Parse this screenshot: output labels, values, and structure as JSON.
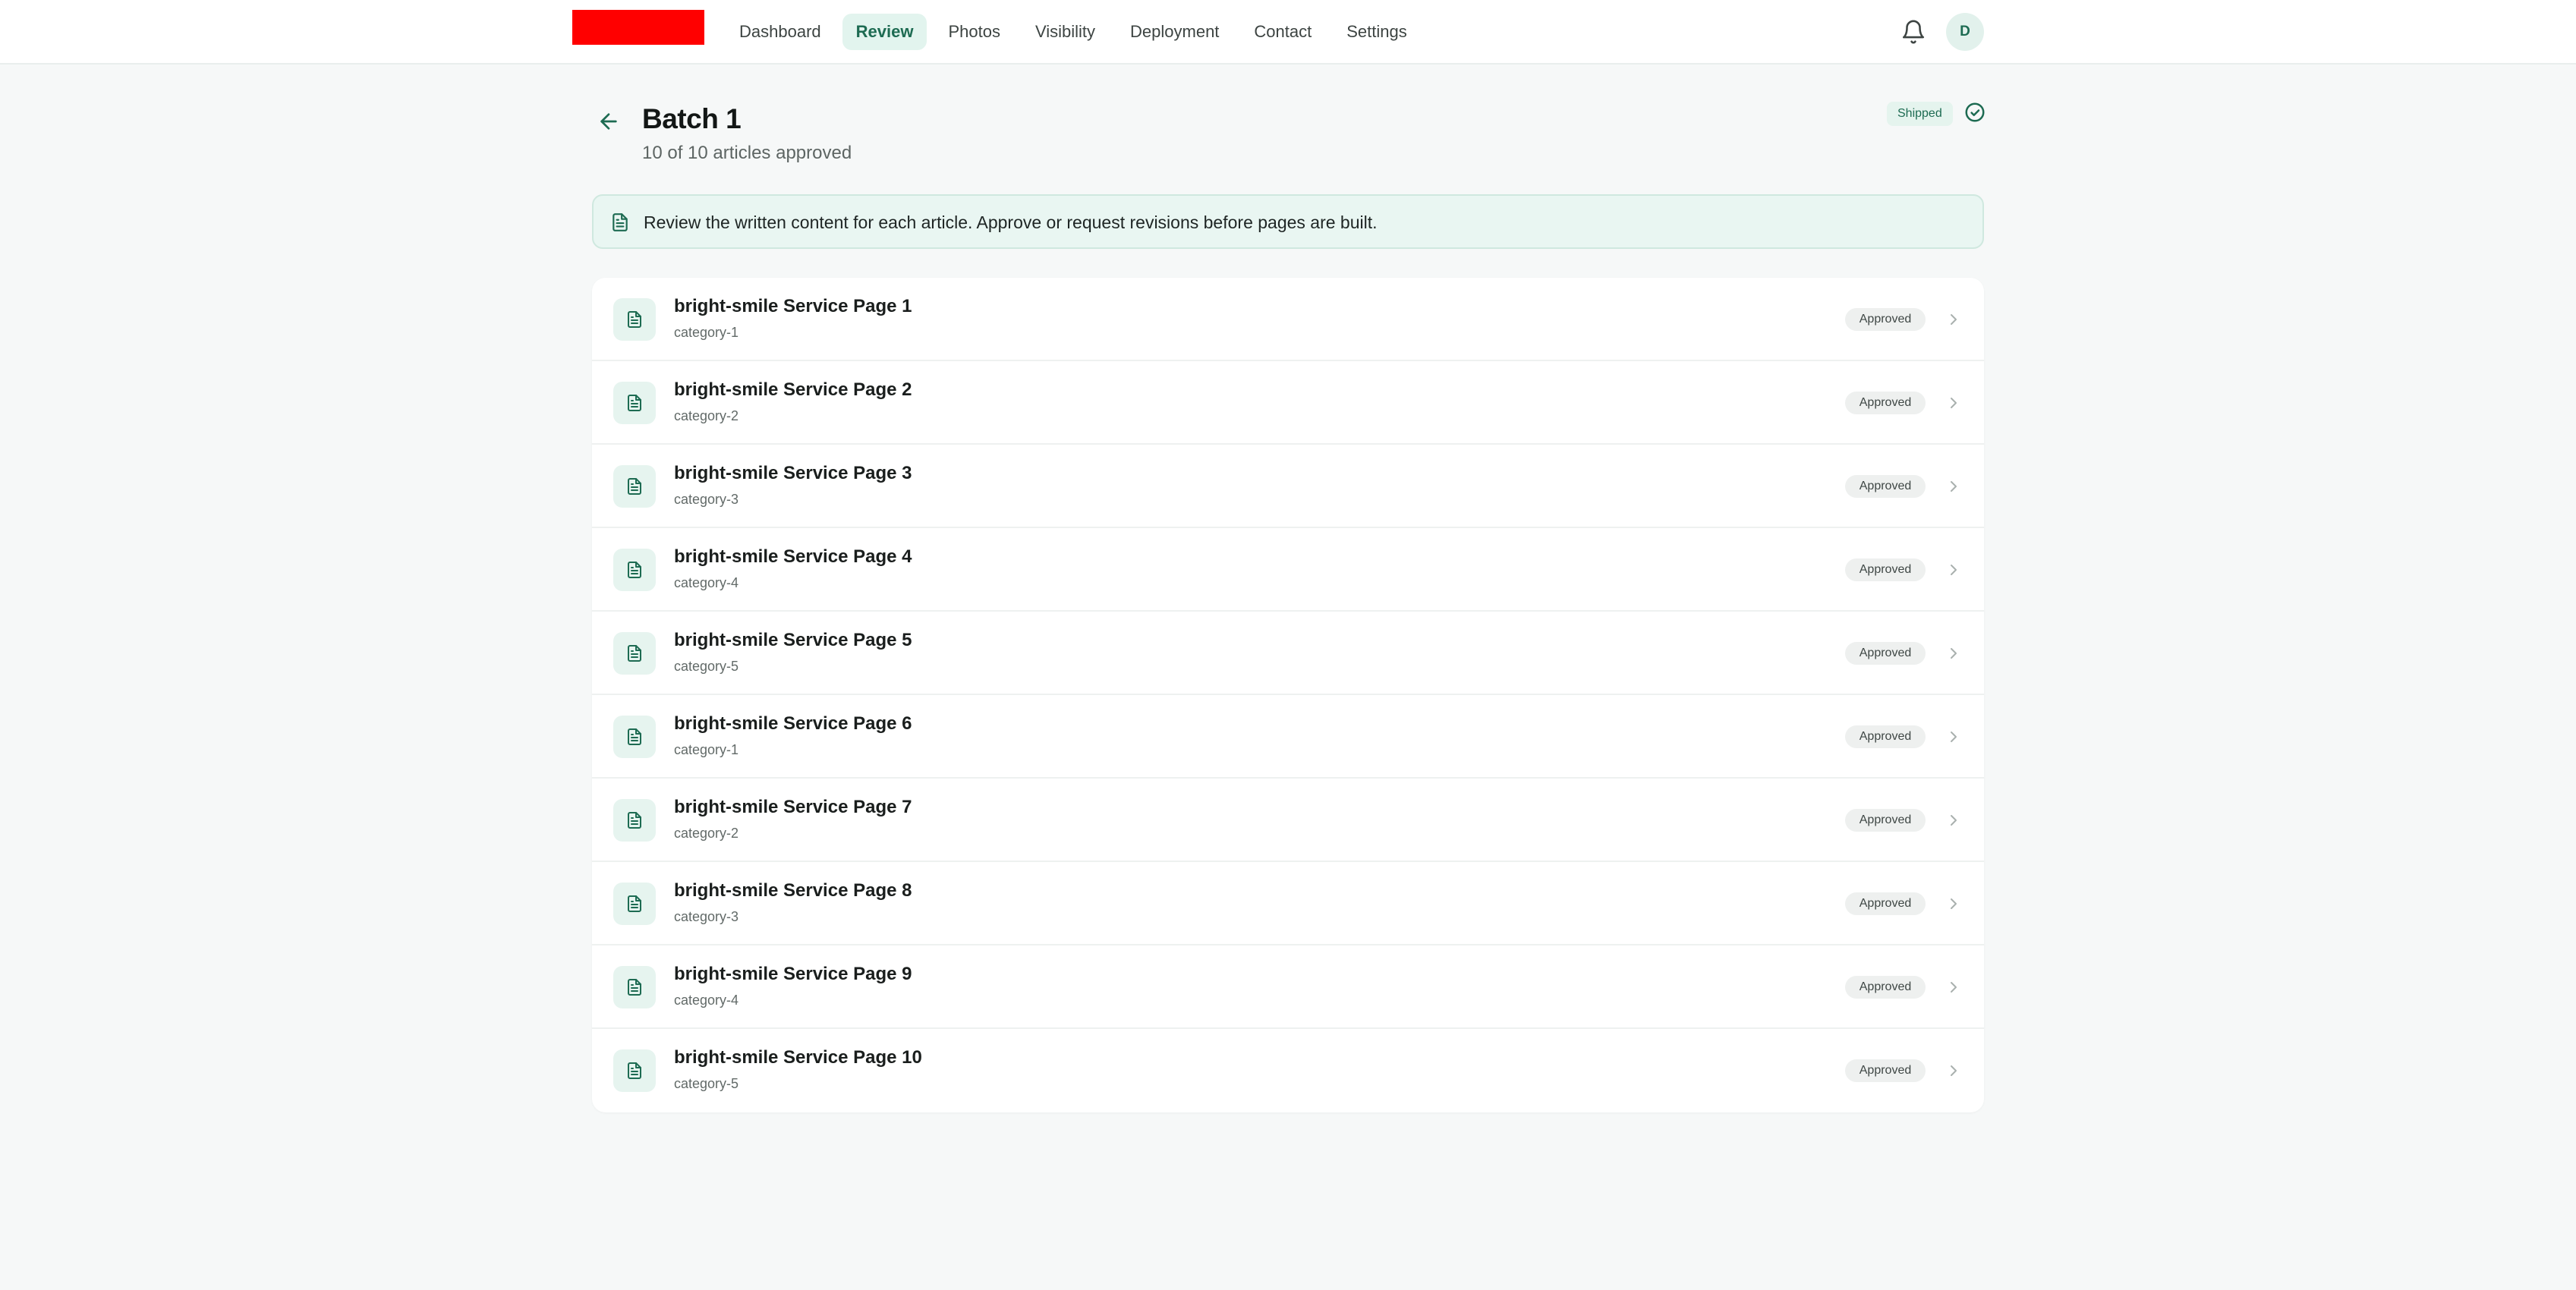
{
  "nav": {
    "items": [
      {
        "label": "Dashboard",
        "active": false
      },
      {
        "label": "Review",
        "active": true
      },
      {
        "label": "Photos",
        "active": false
      },
      {
        "label": "Visibility",
        "active": false
      },
      {
        "label": "Deployment",
        "active": false
      },
      {
        "label": "Contact",
        "active": false
      },
      {
        "label": "Settings",
        "active": false
      }
    ],
    "avatar_initial": "D",
    "icons": [
      "bell-icon"
    ]
  },
  "header": {
    "title": "Batch 1",
    "subtitle": "10 of 10 articles approved",
    "status": "Shipped",
    "icons": [
      "arrow-left-icon",
      "circle-check-icon"
    ]
  },
  "banner": {
    "text": "Review the written content for each article. Approve or request revisions before pages are built.",
    "icon": "document-icon"
  },
  "articles": [
    {
      "title": "bright-smile Service Page 1",
      "category": "category-1",
      "status": "Approved"
    },
    {
      "title": "bright-smile Service Page 2",
      "category": "category-2",
      "status": "Approved"
    },
    {
      "title": "bright-smile Service Page 3",
      "category": "category-3",
      "status": "Approved"
    },
    {
      "title": "bright-smile Service Page 4",
      "category": "category-4",
      "status": "Approved"
    },
    {
      "title": "bright-smile Service Page 5",
      "category": "category-5",
      "status": "Approved"
    },
    {
      "title": "bright-smile Service Page 6",
      "category": "category-1",
      "status": "Approved"
    },
    {
      "title": "bright-smile Service Page 7",
      "category": "category-2",
      "status": "Approved"
    },
    {
      "title": "bright-smile Service Page 8",
      "category": "category-3",
      "status": "Approved"
    },
    {
      "title": "bright-smile Service Page 9",
      "category": "category-4",
      "status": "Approved"
    },
    {
      "title": "bright-smile Service Page 10",
      "category": "category-5",
      "status": "Approved"
    }
  ],
  "colors": {
    "accent": "#1d6b52",
    "accent_bg": "#e2f4ee",
    "logo": "#ff0000",
    "page_bg": "#f6f8f8"
  }
}
